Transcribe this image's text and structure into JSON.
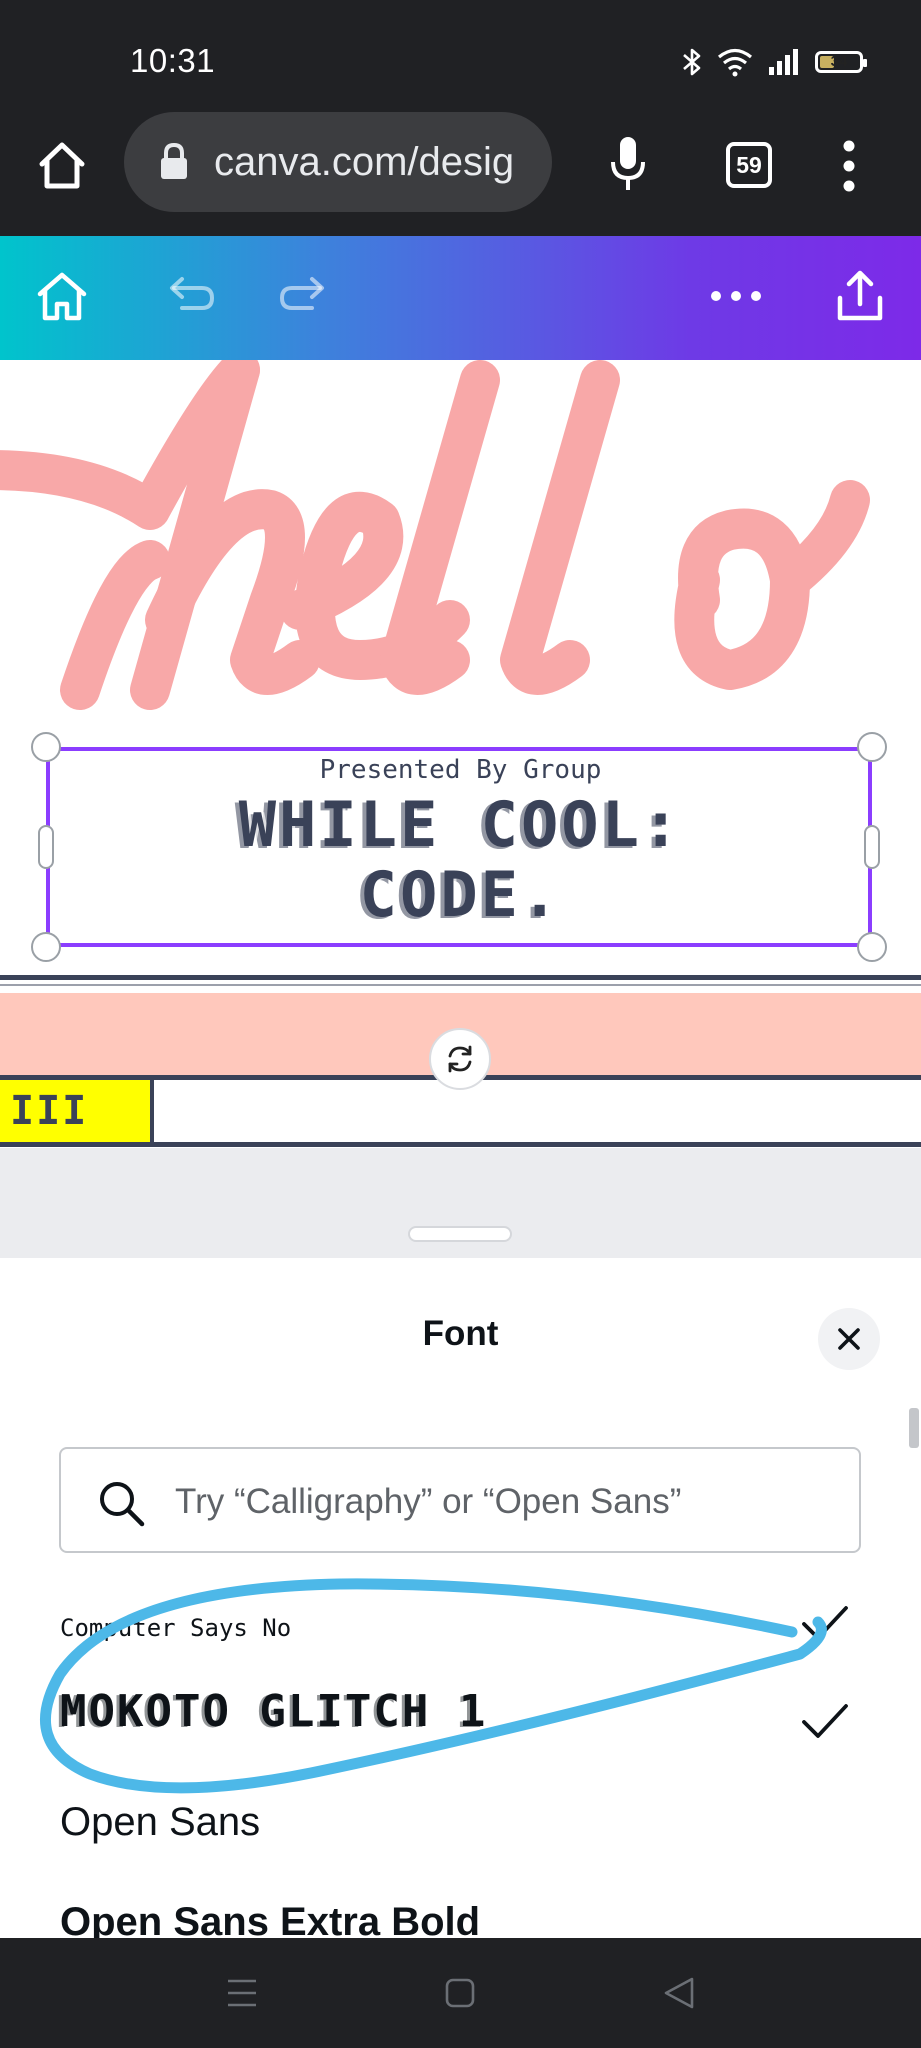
{
  "status_bar": {
    "time": "10:31",
    "battery": "34"
  },
  "browser": {
    "url": "canva.com/desig",
    "tab_count": "59"
  },
  "canvas": {
    "subtitle": "Presented By Group",
    "title_line1": "WHILE COOL:",
    "title_line2": "CODE."
  },
  "yellow_box": {
    "text": "III"
  },
  "font_panel": {
    "title": "Font",
    "search_placeholder": "Try “Calligraphy” or “Open Sans”",
    "fonts": [
      {
        "name": "Computer Says No",
        "checked": true
      },
      {
        "name": "MOKOTO GLITCH 1",
        "checked": true
      },
      {
        "name": "Open Sans",
        "checked": false
      },
      {
        "name": "Open Sans Extra Bold",
        "checked": false
      }
    ]
  },
  "colors": {
    "toolbar_gradient_start": "#00c4cc",
    "toolbar_gradient_end": "#7d2ae8",
    "hello_pink": "#f8a8a8",
    "selection_purple": "#8b3dff",
    "annotation_blue": "#4db8e8",
    "band_peach": "#ffc8bc",
    "box_yellow": "#ffff00"
  }
}
